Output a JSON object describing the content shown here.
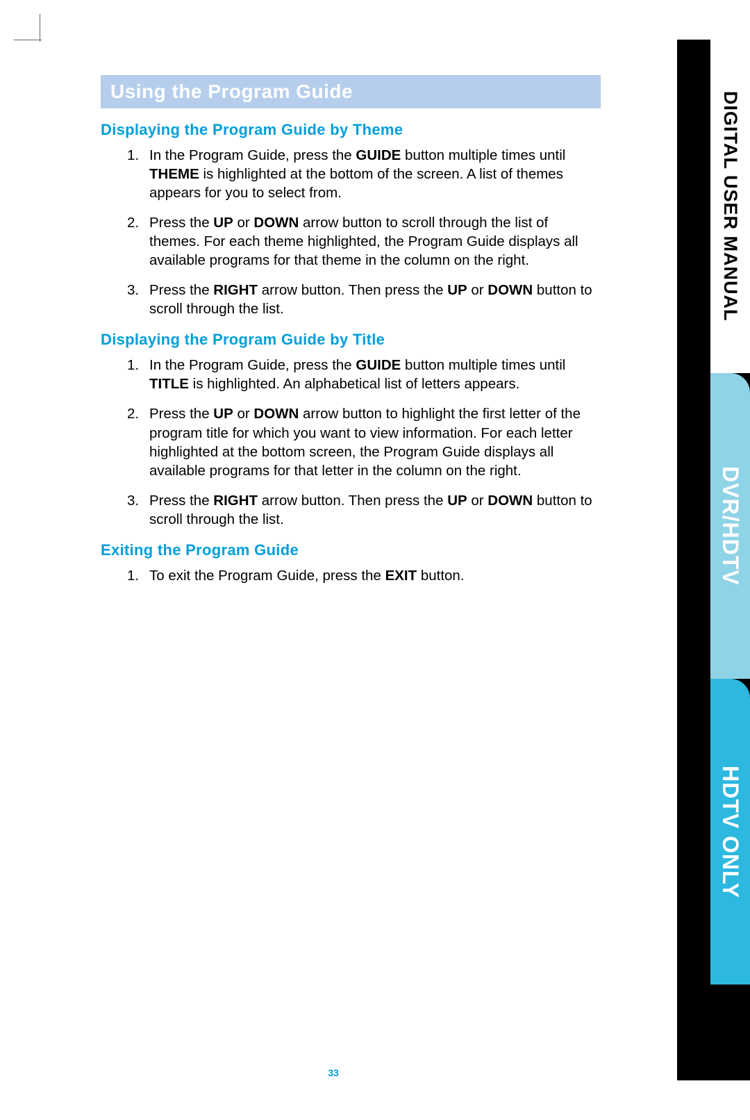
{
  "header": "Using the Program Guide",
  "sections": [
    {
      "title": "Displaying the Program Guide by Theme",
      "steps": [
        {
          "num": "1.",
          "pre": "In the Program Guide, press the ",
          "b1": "GUIDE",
          "mid1": " button multiple times until ",
          "b2": "THEME",
          "mid2": " is highlighted at the bottom of the screen. A list of themes appears for you to select from."
        },
        {
          "num": "2.",
          "pre": "Press the ",
          "b1": "UP",
          "mid1": " or ",
          "b2": "DOWN",
          "mid2": " arrow button to scroll through the list of themes. For each theme highlighted, the Program Guide displays all available programs for that theme in the column on the right."
        },
        {
          "num": "3.",
          "pre": "Press the ",
          "b1": "RIGHT",
          "mid1": " arrow button. Then press the ",
          "b2": "UP",
          "mid2": " or ",
          "b3": "DOWN",
          "mid3": " button to scroll through the list."
        }
      ]
    },
    {
      "title": "Displaying the Program Guide by Title",
      "steps": [
        {
          "num": "1.",
          "pre": "In the Program Guide, press the ",
          "b1": "GUIDE",
          "mid1": " button multiple times until ",
          "b2": "TITLE",
          "mid2": " is highlighted. An alphabetical list of letters appears."
        },
        {
          "num": "2.",
          "pre": "Press the ",
          "b1": "UP",
          "mid1": " or ",
          "b2": "DOWN",
          "mid2": " arrow button to highlight the first letter of the program title for which you want to view information. For each letter highlighted at the bottom screen, the Program Guide displays all available programs for that letter in the column on the right."
        },
        {
          "num": "3.",
          "pre": "Press the ",
          "b1": "RIGHT",
          "mid1": " arrow button. Then press the ",
          "b2": "UP",
          "mid2": " or ",
          "b3": "DOWN",
          "mid3": " button to scroll through the list."
        }
      ]
    },
    {
      "title": "Exiting the Program Guide",
      "steps": [
        {
          "num": "1.",
          "pre": "To exit the Program Guide, press the ",
          "b1": "EXIT",
          "mid1": " button."
        }
      ]
    }
  ],
  "tabs": {
    "t1": "DIGITAL USER MANUAL",
    "t2": "DVR/HDTV",
    "t3": "HDTV ONLY"
  },
  "page_number": "33"
}
